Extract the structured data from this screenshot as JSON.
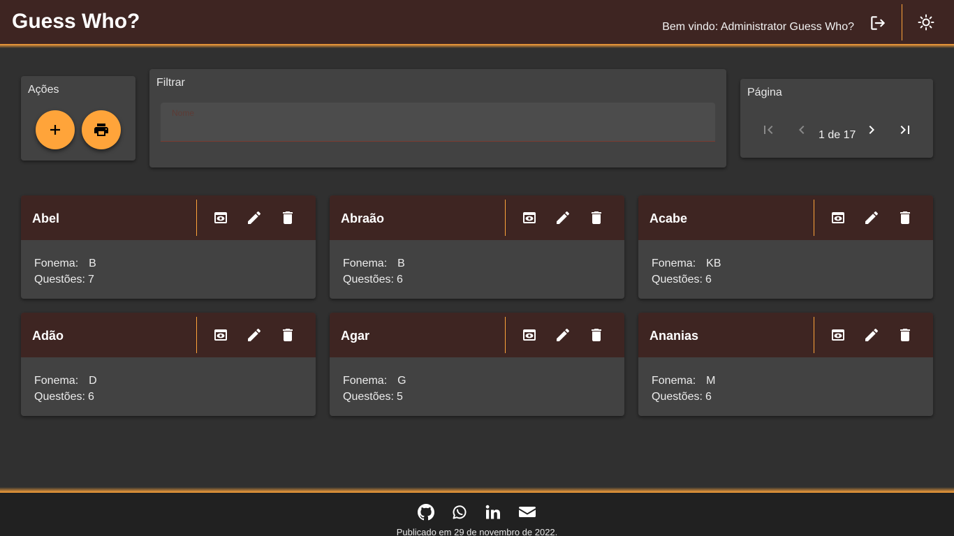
{
  "header": {
    "title": "Guess Who?",
    "welcome": "Bem vindo: Administrator Guess Who?",
    "logout_icon": "logout-icon",
    "theme_icon": "sun-icon"
  },
  "colors": {
    "accent": "#ffa43a",
    "header_bg": "#3e2522",
    "panel_bg": "#424242",
    "page_bg": "#303030",
    "footer_bg": "#212121"
  },
  "actions": {
    "title": "Ações",
    "add_icon": "plus-icon",
    "print_icon": "printer-icon"
  },
  "filter": {
    "title": "Filtrar",
    "name_label": "Nome",
    "name_value": ""
  },
  "pagination": {
    "title": "Página",
    "text": "1 de 17"
  },
  "cards": [
    {
      "name": "Abel",
      "fonema_label": "Fonema:",
      "fonema": "B",
      "questoes_label": "Questões:",
      "questoes": "7"
    },
    {
      "name": "Abraão",
      "fonema_label": "Fonema:",
      "fonema": "B",
      "questoes_label": "Questões:",
      "questoes": "6"
    },
    {
      "name": "Acabe",
      "fonema_label": "Fonema:",
      "fonema": "KB",
      "questoes_label": "Questões:",
      "questoes": "6"
    },
    {
      "name": "Adão",
      "fonema_label": "Fonema:",
      "fonema": "D",
      "questoes_label": "Questões:",
      "questoes": "6"
    },
    {
      "name": "Agar",
      "fonema_label": "Fonema:",
      "fonema": "G",
      "questoes_label": "Questões:",
      "questoes": "5"
    },
    {
      "name": "Ananias",
      "fonema_label": "Fonema:",
      "fonema": "M",
      "questoes_label": "Questões:",
      "questoes": "6"
    }
  ],
  "card_action_icons": [
    "view-icon",
    "edit-icon",
    "delete-icon"
  ],
  "footer": {
    "social_icons": [
      "github-icon",
      "whatsapp-icon",
      "linkedin-icon",
      "email-icon"
    ],
    "published": "Publicado em 29 de novembro de 2022."
  }
}
